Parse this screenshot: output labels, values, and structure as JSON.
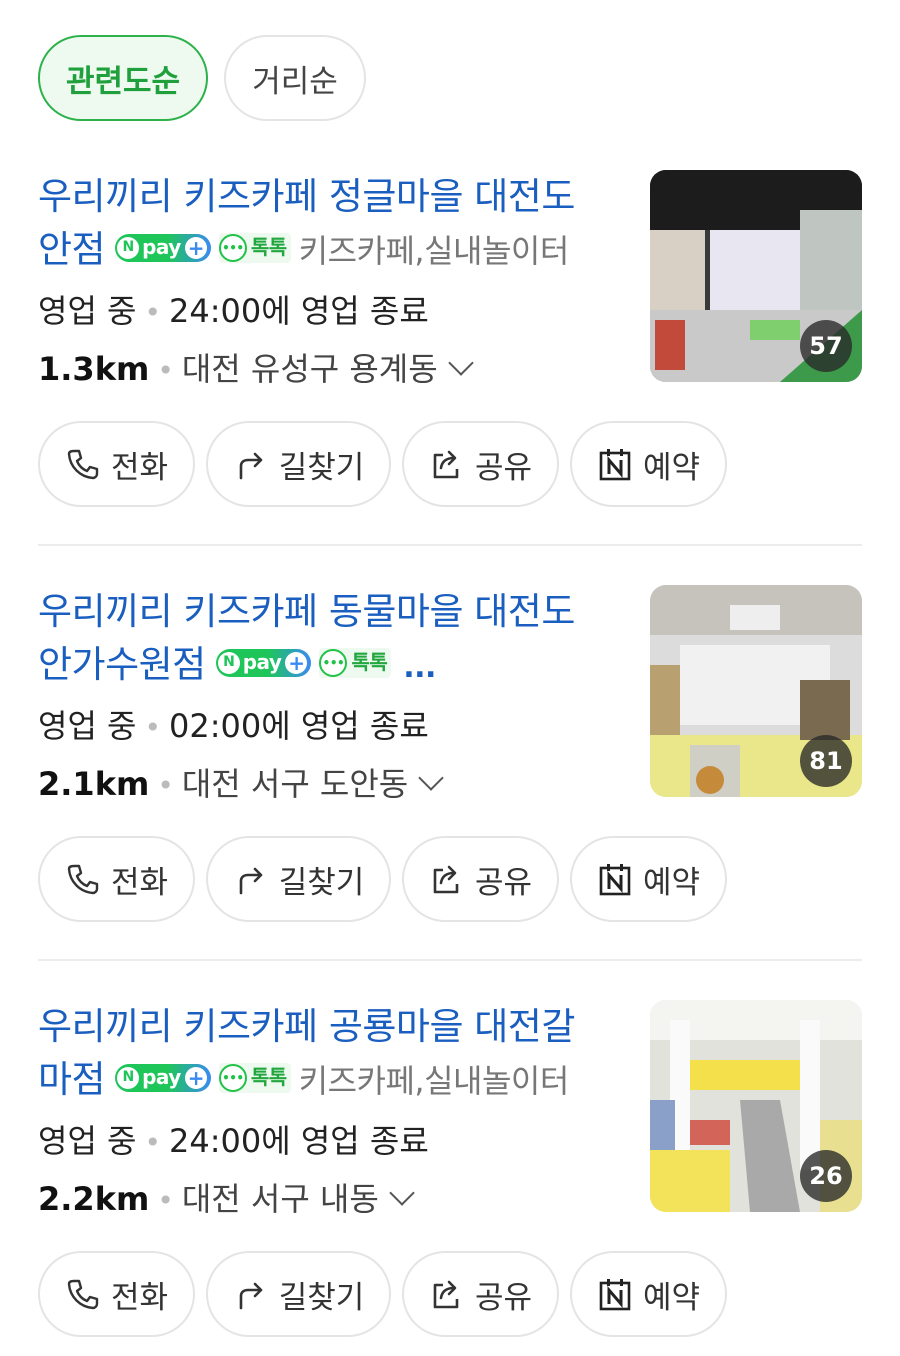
{
  "sort": {
    "relevance": "관련도순",
    "distance": "거리순"
  },
  "badges": {
    "npay_n": "N",
    "npay_text": "pay",
    "npay_plus": "+",
    "talk_text": "톡톡"
  },
  "actions": {
    "call": "전화",
    "route": "길찾기",
    "share": "공유",
    "book": "예약"
  },
  "places": [
    {
      "title_line1": "우리끼리 키즈카페 정글마을 대전도",
      "title_line2": "안점",
      "category": "키즈카페,실내놀이터",
      "status": "영업 중",
      "hours": "24:00에 영업 종료",
      "distance": "1.3km",
      "address": "대전 유성구 용계동",
      "photo_count": "57"
    },
    {
      "title_line1": "우리끼리 키즈카페 동물마을 대전도",
      "title_line2": "안가수원점",
      "more": "...",
      "status": "영업 중",
      "hours": "02:00에 영업 종료",
      "distance": "2.1km",
      "address": "대전 서구 도안동",
      "photo_count": "81"
    },
    {
      "title_line1": "우리끼리 키즈카페 공룡마을 대전갈",
      "title_line2": "마점",
      "category": "키즈카페,실내놀이터",
      "status": "영업 중",
      "hours": "24:00에 영업 종료",
      "distance": "2.2km",
      "address": "대전 서구 내동",
      "photo_count": "26"
    }
  ]
}
